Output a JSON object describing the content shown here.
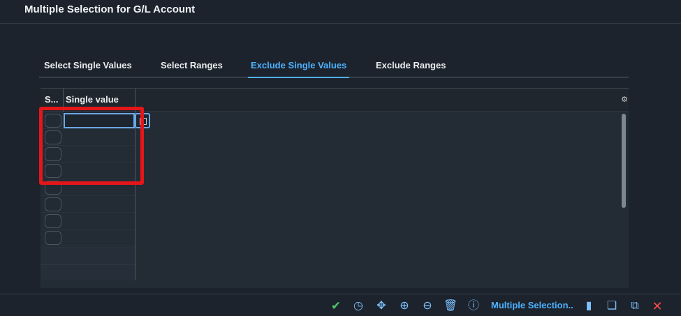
{
  "dialog": {
    "title": "Multiple Selection for G/L Account"
  },
  "tabs": [
    {
      "label": "Select Single Values",
      "selected": false
    },
    {
      "label": "Select Ranges",
      "selected": false
    },
    {
      "label": "Exclude Single Values",
      "selected": true
    },
    {
      "label": "Exclude Ranges",
      "selected": false
    }
  ],
  "table": {
    "columns": {
      "sel": "S...",
      "value": "Single value"
    },
    "rows": [
      {
        "value": ""
      },
      {
        "value": ""
      },
      {
        "value": ""
      },
      {
        "value": ""
      },
      {
        "value": ""
      },
      {
        "value": ""
      },
      {
        "value": ""
      },
      {
        "value": ""
      }
    ]
  },
  "toolbar": {
    "label": "Multiple Selection..",
    "icons": [
      "check-icon",
      "clock-icon",
      "move-icon",
      "add-icon",
      "remove-icon",
      "delete-icon",
      "info-icon",
      "comment-icon",
      "paste-icon",
      "import-icon",
      "close-icon"
    ]
  },
  "colors": {
    "accent": "#4db1ff",
    "highlight": "#e4161a",
    "background": "#1d232c"
  }
}
